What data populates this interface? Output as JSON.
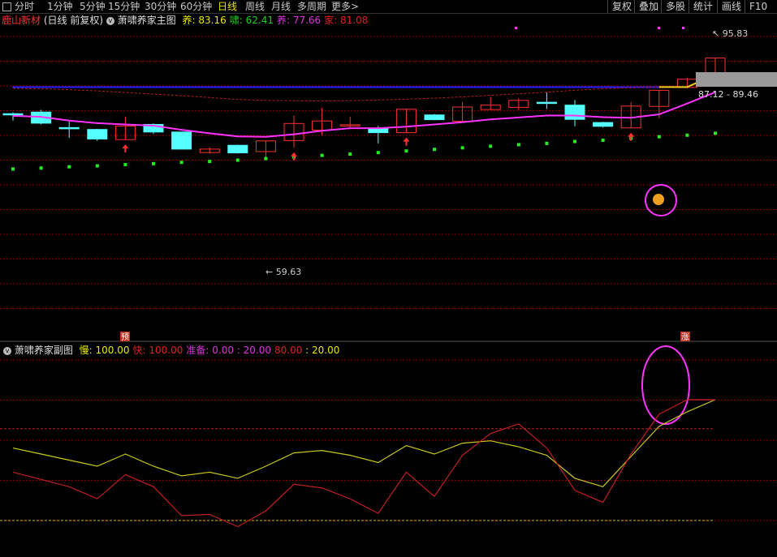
{
  "toolbar": {
    "periods": [
      "分时",
      "1分钟",
      "5分钟",
      "15分钟",
      "30分钟",
      "60分钟",
      "日线",
      "周线",
      "月线",
      "多周期",
      "更多>"
    ],
    "active_period": "日线",
    "right_buttons": [
      "复权",
      "叠加",
      "多股",
      "统计",
      "画线",
      "F10"
    ]
  },
  "main_legend": {
    "stock_name": "鹿山新材",
    "mode": "(日线 前复权)",
    "indicator": "萧啸养家主图",
    "items": [
      {
        "label": "养",
        "value": "83.16",
        "color": "#e8e800"
      },
      {
        "label": "啸",
        "value": "62.41",
        "color": "#22cc22"
      },
      {
        "label": "养",
        "value": "77.66",
        "color": "#dd33dd"
      },
      {
        "label": "家",
        "value": "81.08",
        "color": "#dd2222"
      }
    ]
  },
  "sub_legend": {
    "indicator": "萧啸养家副图",
    "items": [
      {
        "label": "慢",
        "value": "100.00",
        "color": "#e8e800"
      },
      {
        "label": "快",
        "value": "100.00",
        "color": "#dd2222"
      },
      {
        "label": "准备",
        "value": "0.00",
        "value2": "20.00",
        "color": "#dd33dd"
      },
      {
        "label": "",
        "value": "80.00",
        "value2": "20.00",
        "color": "#dd2222",
        "alt_color": "#e8e800"
      }
    ]
  },
  "annotations": {
    "high_label": "95.83",
    "low_label": "59.63",
    "price_range": "87.12 - 89.46",
    "marker_yu": "预",
    "marker_zhang": "涨"
  },
  "colors": {
    "up": "#ff3030",
    "down": "#54ffff",
    "doji": "#ff3030",
    "ma_line": "#ff33ff",
    "blue_line": "#2020ff",
    "dots": "#22ee22",
    "grid": "#8b0000"
  },
  "chart_data": {
    "type": "candlestick",
    "main": {
      "ylim": [
        50,
        100
      ],
      "candles": [
        {
          "o": 82.0,
          "c": 81.6,
          "h": 82.4,
          "l": 79.8,
          "dir": "down"
        },
        {
          "o": 82.5,
          "c": 79.0,
          "h": 83.2,
          "l": 78.6,
          "dir": "down"
        },
        {
          "o": 77.6,
          "c": 77.3,
          "h": 79.5,
          "l": 74.3,
          "dir": "down"
        },
        {
          "o": 77.0,
          "c": 74.0,
          "h": 77.2,
          "l": 73.4,
          "dir": "down"
        },
        {
          "o": 73.8,
          "c": 78.1,
          "h": 81.0,
          "l": 73.8,
          "dir": "up"
        },
        {
          "o": 78.6,
          "c": 76.2,
          "h": 78.9,
          "l": 75.6,
          "dir": "down"
        },
        {
          "o": 76.2,
          "c": 70.8,
          "h": 76.2,
          "l": 70.8,
          "dir": "down"
        },
        {
          "o": 69.7,
          "c": 70.8,
          "h": 71.4,
          "l": 69.4,
          "dir": "up"
        },
        {
          "o": 72.0,
          "c": 69.6,
          "h": 72.2,
          "l": 69.4,
          "dir": "down"
        },
        {
          "o": 70.0,
          "c": 73.4,
          "h": 73.4,
          "l": 67.5,
          "dir": "up"
        },
        {
          "o": 73.5,
          "c": 78.9,
          "h": 81.4,
          "l": 71.3,
          "dir": "up"
        },
        {
          "o": 76.8,
          "c": 79.7,
          "h": 83.8,
          "l": 75.2,
          "dir": "up"
        },
        {
          "o": 78.1,
          "c": 78.5,
          "h": 81.0,
          "l": 77.7,
          "dir": "up"
        },
        {
          "o": 77.2,
          "c": 76.0,
          "h": 78.1,
          "l": 72.6,
          "dir": "down"
        },
        {
          "o": 76.0,
          "c": 83.4,
          "h": 83.4,
          "l": 76.0,
          "dir": "up"
        },
        {
          "o": 81.6,
          "c": 80.1,
          "h": 81.9,
          "l": 79.9,
          "dir": "down"
        },
        {
          "o": 79.6,
          "c": 84.1,
          "h": 85.7,
          "l": 79.6,
          "dir": "up"
        },
        {
          "o": 83.3,
          "c": 84.7,
          "h": 87.3,
          "l": 83.3,
          "dir": "up"
        },
        {
          "o": 84.0,
          "c": 86.2,
          "h": 86.8,
          "l": 83.2,
          "dir": "up"
        },
        {
          "o": 85.6,
          "c": 85.3,
          "h": 88.7,
          "l": 83.5,
          "dir": "down"
        },
        {
          "o": 84.7,
          "c": 80.2,
          "h": 86.3,
          "l": 78.0,
          "dir": "down"
        },
        {
          "o": 79.2,
          "c": 78.0,
          "h": 79.4,
          "l": 77.6,
          "dir": "down"
        },
        {
          "o": 77.5,
          "c": 84.4,
          "h": 85.6,
          "l": 77.5,
          "dir": "up"
        },
        {
          "o": 84.3,
          "c": 89.4,
          "h": 89.4,
          "l": 80.6,
          "dir": "up"
        },
        {
          "o": 90.3,
          "c": 92.9,
          "h": 93.4,
          "l": 90.0,
          "dir": "up"
        },
        {
          "o": 93.2,
          "c": 99.6,
          "h": 99.6,
          "l": 93.2,
          "dir": "up"
        }
      ],
      "ma_line": [
        81.3,
        81.0,
        79.8,
        79.0,
        78.6,
        78.2,
        76.9,
        75.8,
        74.8,
        74.7,
        75.5,
        76.6,
        77.4,
        77.4,
        77.9,
        78.6,
        79.3,
        80.2,
        80.8,
        81.4,
        81.4,
        80.9,
        80.7,
        81.8,
        85.2,
        88.8
      ],
      "dashed_line": [
        90.0,
        89.9,
        89.6,
        89.2,
        88.7,
        88.2,
        87.7,
        87.1,
        86.5,
        86.2,
        86.1,
        86.0,
        86.1,
        86.3,
        86.6,
        86.9,
        87.3,
        87.8,
        88.3,
        88.8,
        89.4,
        89.9,
        90.2,
        90.5
      ],
      "blue_level": 90.4,
      "yellow_line": [
        90.4,
        90.4,
        94.4
      ],
      "dots": [
        64.5,
        64.8,
        65.2,
        65.5,
        65.9,
        66.2,
        66.6,
        66.9,
        67.3,
        67.8,
        68.3,
        68.8,
        69.2,
        69.7,
        70.2,
        70.7,
        71.2,
        71.7,
        72.2,
        72.6,
        73.2,
        73.6,
        74.2,
        74.7,
        75.2,
        75.8
      ]
    },
    "sub": {
      "ylim": [
        0,
        100
      ],
      "slow": [
        60,
        55,
        50,
        45,
        55,
        45,
        37,
        40,
        35,
        45,
        56,
        58,
        54,
        48,
        62,
        55,
        64,
        66,
        61,
        54,
        35,
        28,
        53,
        78,
        90,
        100
      ],
      "fast": [
        40,
        34,
        28,
        18,
        38,
        28,
        4,
        5,
        -5,
        8,
        30,
        27,
        18,
        6,
        40,
        20,
        54,
        72,
        80,
        60,
        25,
        15,
        55,
        88,
        100,
        100
      ],
      "levels": [
        80,
        0
      ]
    }
  }
}
